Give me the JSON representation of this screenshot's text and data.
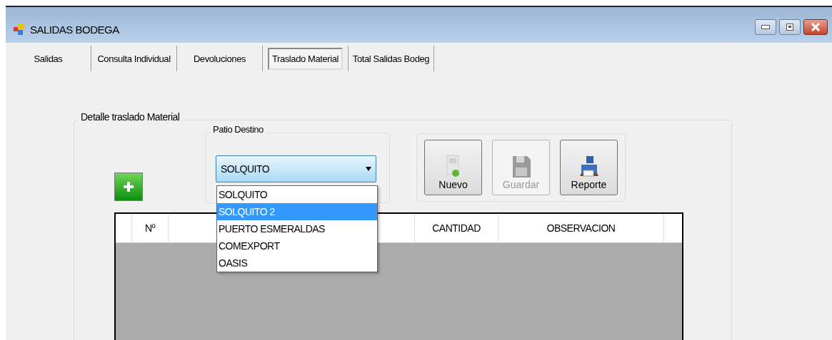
{
  "window": {
    "title": "SALIDAS BODEGA"
  },
  "tabs": [
    {
      "label": "Salidas",
      "selected": false
    },
    {
      "label": "Consulta Individual",
      "selected": false
    },
    {
      "label": "Devoluciones",
      "selected": false
    },
    {
      "label": "Traslado Material",
      "selected": true
    },
    {
      "label": "Total Salidas Bodeg",
      "selected": false
    }
  ],
  "group": {
    "title": "Detalle traslado Material"
  },
  "patio": {
    "title": "Patio Destino",
    "value": "SOLQUITO",
    "options": [
      {
        "label": "SOLQUITO",
        "highlighted": false
      },
      {
        "label": "SOLQUITO 2",
        "highlighted": true
      },
      {
        "label": "PUERTO ESMERALDAS",
        "highlighted": false
      },
      {
        "label": "COMEXPORT",
        "highlighted": false
      },
      {
        "label": "OASIS",
        "highlighted": false
      }
    ]
  },
  "buttons": [
    {
      "kind": "new",
      "label": "Nuevo",
      "disabled": false
    },
    {
      "kind": "save",
      "label": "Guardar",
      "disabled": true
    },
    {
      "kind": "report",
      "label": "Reporte",
      "disabled": false
    }
  ],
  "table": {
    "columns": [
      {
        "label": "Nº"
      },
      {
        "label": "CANTIDAD"
      },
      {
        "label": "OBSERVACION"
      }
    ]
  }
}
